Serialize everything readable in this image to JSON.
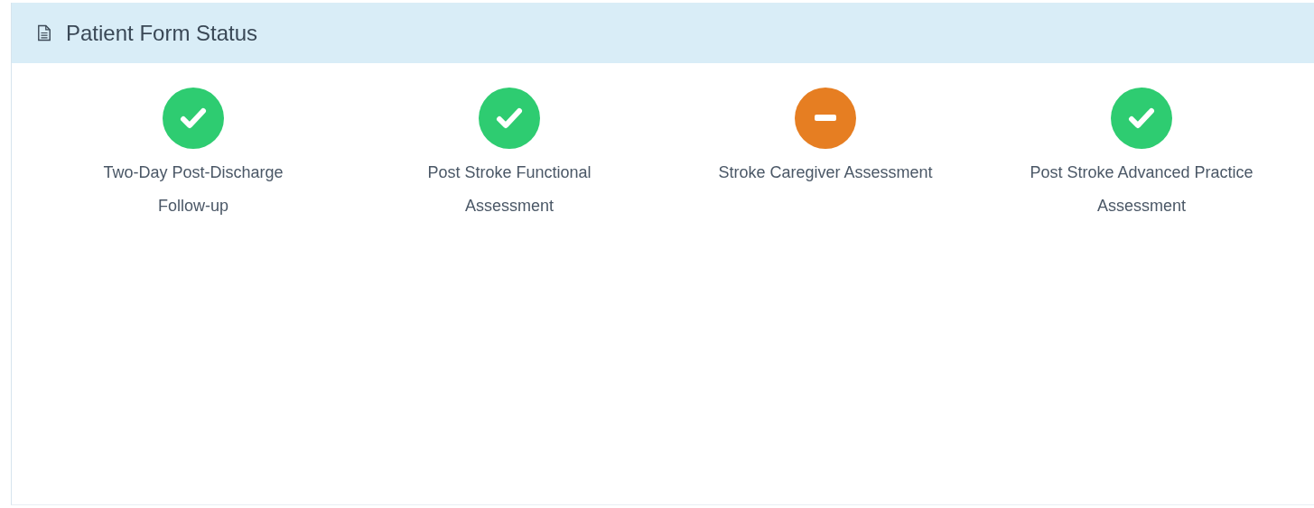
{
  "panel": {
    "title": "Patient Form Status"
  },
  "forms": [
    {
      "label": "Two-Day Post-Discharge Follow-up",
      "kind": "check"
    },
    {
      "label": "Post Stroke Functional Assessment",
      "kind": "check"
    },
    {
      "label": "Stroke Caregiver Assessment",
      "kind": "minus"
    },
    {
      "label": "Post Stroke Advanced Practice Assessment",
      "kind": "check"
    }
  ]
}
